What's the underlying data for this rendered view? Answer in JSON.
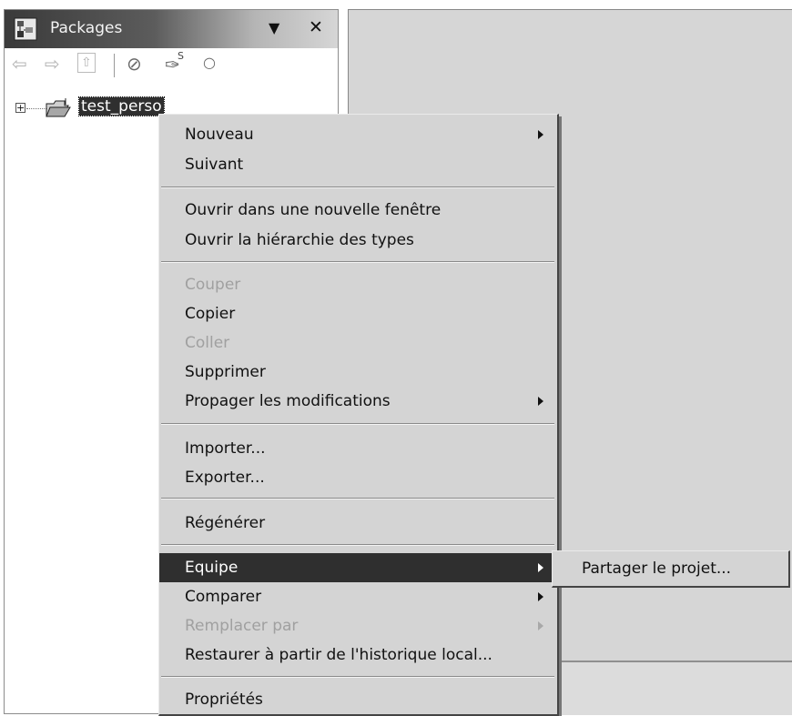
{
  "view": {
    "title": "Packages",
    "icon": "package-explorer-icon",
    "menu_glyph": "▼",
    "close_glyph": "✕"
  },
  "toolbar": {
    "back_glyph": "⇦",
    "forward_glyph": "⇨",
    "up_glyph": "⇧",
    "filter_glyph": "⊘",
    "link_glyph": "✑",
    "link_superscript": "S",
    "dot_glyph": "○"
  },
  "tree": {
    "expand_glyph": "+",
    "project_label": "test_perso"
  },
  "context_menu": {
    "nouveau": "Nouveau",
    "suivant": "Suivant",
    "ouvrir_fenetre": "Ouvrir dans une nouvelle fenêtre",
    "ouvrir_hierarchie": "Ouvrir la hiérarchie des types",
    "couper": "Couper",
    "copier": "Copier",
    "coller": "Coller",
    "supprimer": "Supprimer",
    "propager": "Propager les modifications",
    "importer": "Importer...",
    "exporter": "Exporter...",
    "regenerer": "Régénérer",
    "equipe": "Equipe",
    "comparer": "Comparer",
    "remplacer": "Remplacer par",
    "restaurer": "Restaurer à partir de l'historique local...",
    "proprietes": "Propriétés"
  },
  "submenu": {
    "partager": "Partager le projet..."
  },
  "colors": {
    "highlight": "#2f2f2f",
    "menu_bg": "#d4d4d4",
    "disabled_text": "#a0a0a0"
  }
}
